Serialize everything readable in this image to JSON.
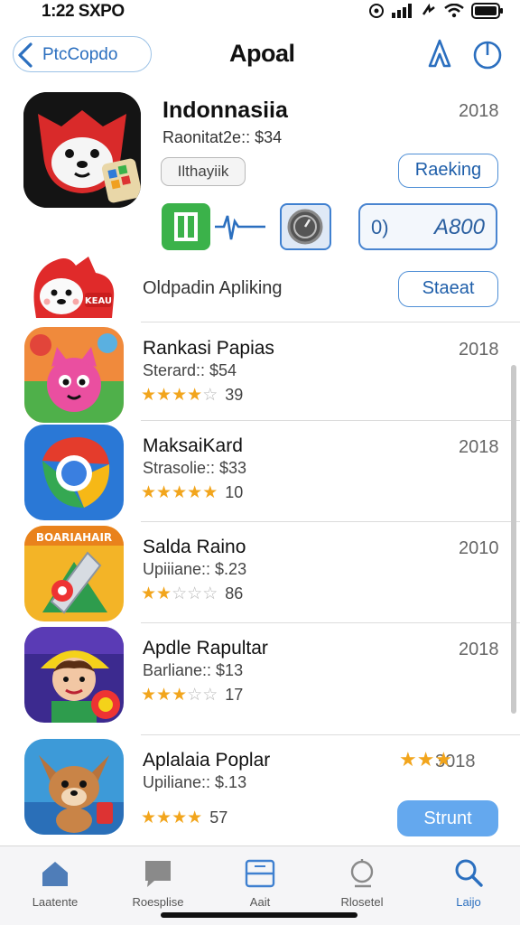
{
  "status_bar": {
    "time": "1:22 SXPO",
    "icons": [
      "location-icon",
      "signal-icon",
      "link-icon",
      "wifi-icon",
      "battery-icon"
    ]
  },
  "nav": {
    "back_label": "PtcCopdo",
    "title": "Apoal",
    "right_icons": [
      "share-icon",
      "power-icon"
    ]
  },
  "featured": {
    "title": "Indonnasiia",
    "year": "2018",
    "price": "Raonitat2e:: $34",
    "chip": "Ilthayiik",
    "action_button": "Raeking",
    "counter_value": "A800",
    "counter_prefix": "0)"
  },
  "secondary": {
    "label": "Oldpadin Apliking",
    "button": "Staeat"
  },
  "apps": [
    {
      "name": "Rankasi Papias",
      "price": "Sterard:: $54",
      "year": "2018",
      "rating": 4,
      "count": "39",
      "icon": "pink-cat-game-icon"
    },
    {
      "name": "MaksaiKard",
      "price": "Strasolie:: $33",
      "year": "2018",
      "rating": 5,
      "count": "10",
      "icon": "chrome-like-icon"
    },
    {
      "name": "Salda Raino",
      "price": "Upiiiane:: $.23",
      "year": "2010",
      "rating": 2,
      "count": "86",
      "icon": "rocket-game-icon"
    },
    {
      "name": "Apdle Rapultar",
      "price": "Barliane:: $13",
      "year": "2018",
      "rating": 3,
      "count": "17",
      "icon": "cartoon-boy-icon"
    },
    {
      "name": "Aplalaia Poplar",
      "price": "Upiliane:: $.13",
      "year": "3018",
      "rating": 4,
      "count": "57",
      "icon": "fox-game-icon"
    }
  ],
  "last_row_button": "Strunt",
  "tabs": [
    {
      "label": "Laatente",
      "icon": "home-icon"
    },
    {
      "label": "Roesplise",
      "icon": "chat-icon"
    },
    {
      "label": "Aait",
      "icon": "apps-icon"
    },
    {
      "label": "Rlosetel",
      "icon": "search-doc-icon"
    },
    {
      "label": "Laijo",
      "icon": "search-icon"
    }
  ],
  "colors": {
    "accent": "#2b6fbf",
    "star": "#f2a51c",
    "start_button": "#64a8ee"
  }
}
